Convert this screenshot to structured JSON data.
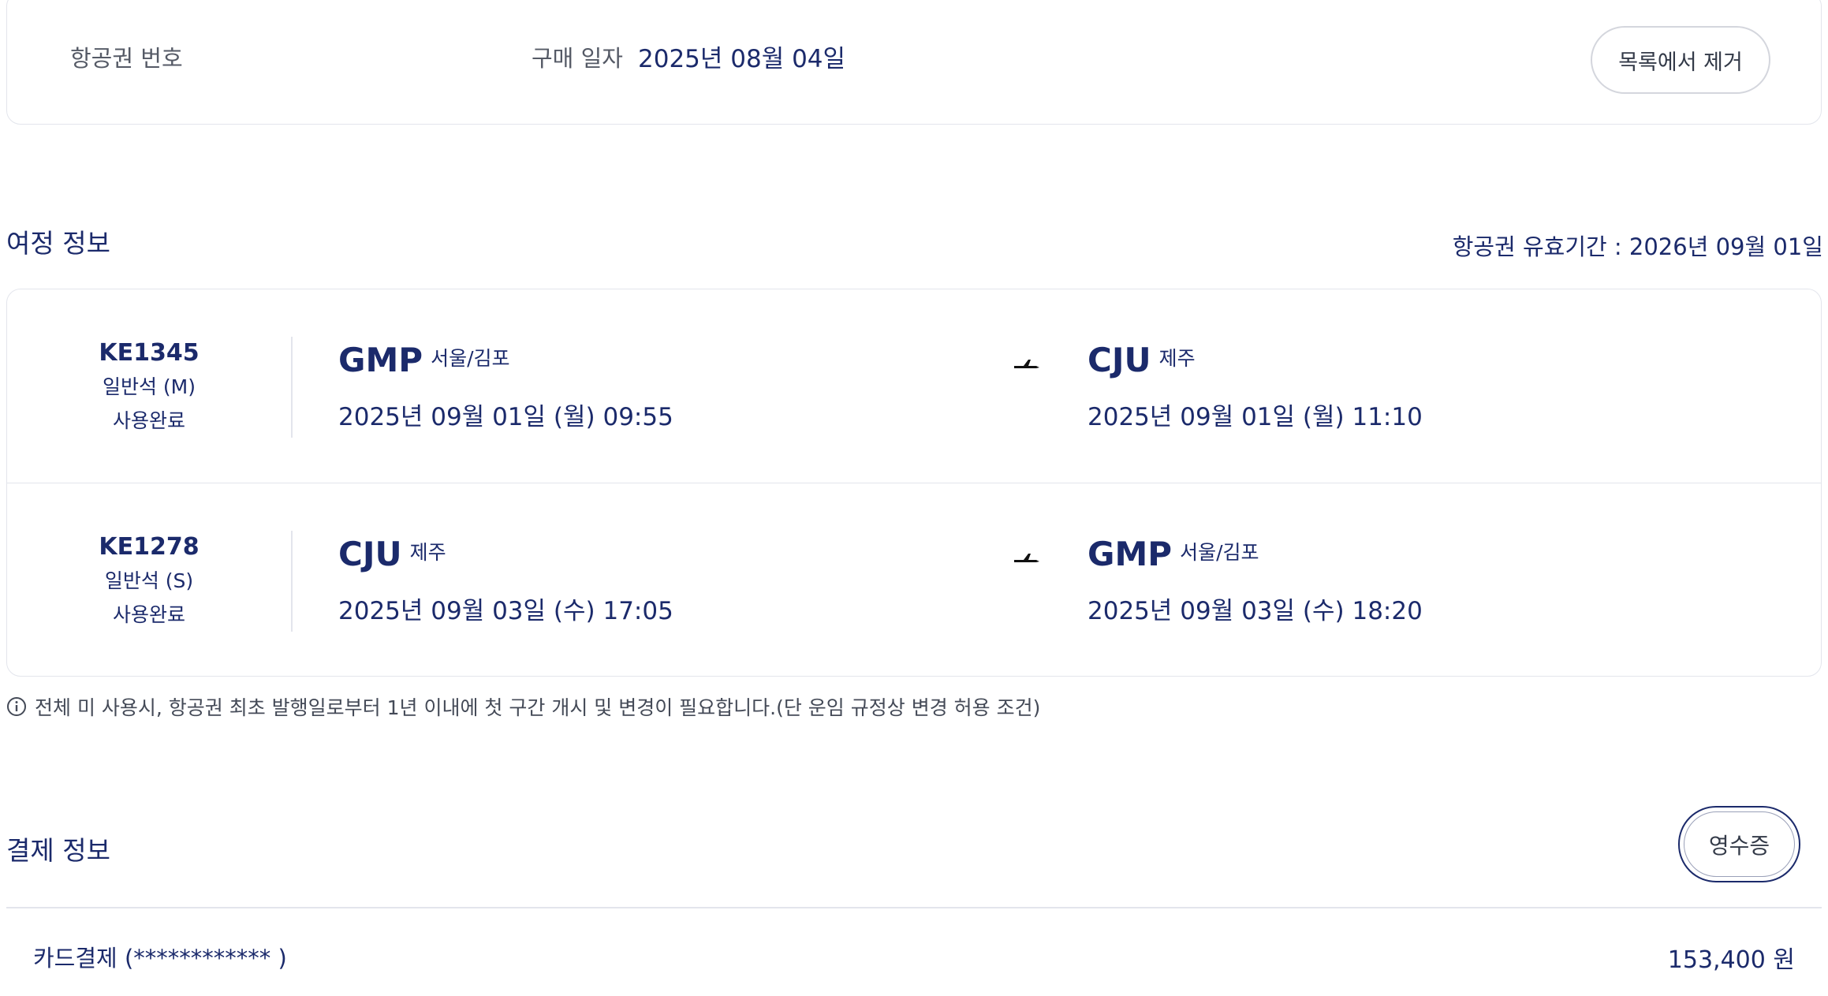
{
  "ticket": {
    "ticket_no_label": "항공권 번호",
    "purchase_label": "구매 일자",
    "purchase_date": "2025년 08월 04일",
    "remove_label": "목록에서 제거"
  },
  "itinerary": {
    "title": "여정 정보",
    "validity": "항공권 유효기간 : 2026년 09월 01일",
    "segments": [
      {
        "flight_no": "KE1345",
        "seat_class": "일반석 (M)",
        "status": "사용완료",
        "dep_code": "GMP",
        "dep_city": "서울/김포",
        "dep_datetime": "2025년 09월 01일 (월) 09:55",
        "arr_code": "CJU",
        "arr_city": "제주",
        "arr_datetime": "2025년 09월 01일 (월) 11:10"
      },
      {
        "flight_no": "KE1278",
        "seat_class": "일반석 (S)",
        "status": "사용완료",
        "dep_code": "CJU",
        "dep_city": "제주",
        "dep_datetime": "2025년 09월 03일 (수) 17:05",
        "arr_code": "GMP",
        "arr_city": "서울/김포",
        "arr_datetime": "2025년 09월 03일 (수) 18:20"
      }
    ],
    "notice": "전체 미 사용시, 항공권 최초 발행일로부터 1년 이내에 첫 구간 개시 및 변경이 필요합니다.(단 운임 규정상 변경 허용 조건)"
  },
  "payment": {
    "title": "결제 정보",
    "receipt_label": "영수증",
    "method": "카드결제 (************             )",
    "amount": "153,400 원"
  },
  "icons": {
    "plane": "plane-icon",
    "info": "info-icon"
  },
  "colors": {
    "brand_navy": "#1b2a6b",
    "border": "#e3e5ec"
  }
}
